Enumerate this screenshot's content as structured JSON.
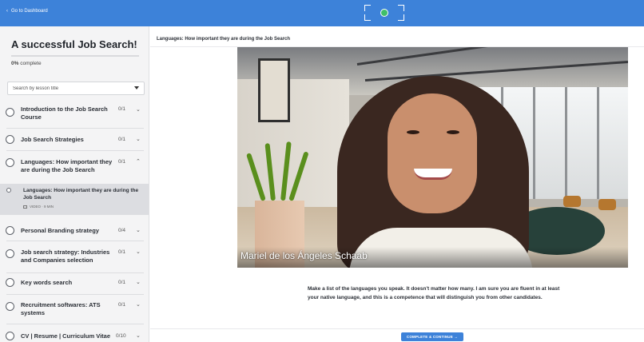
{
  "topbar": {
    "back_label": "Go to Dashboard",
    "back_icon": "chevron-left-icon",
    "logo_icon": "globe-icon",
    "accent_color": "#3d82d9"
  },
  "sidebar": {
    "course_title": "A successful Job Search!",
    "progress_percent": "0%",
    "progress_suffix": "complete",
    "progress_value": 0,
    "search_placeholder": "Search by lesson title",
    "lessons": [
      {
        "title": "Introduction to the Job Search Course",
        "count": "0/1",
        "expanded": false
      },
      {
        "title": "Job Search Strategies",
        "count": "0/1",
        "expanded": false
      },
      {
        "title": "Languages: How important they are during the Job Search",
        "count": "0/1",
        "expanded": true
      },
      {
        "title": "Personal Branding strategy",
        "count": "0/4",
        "expanded": false
      },
      {
        "title": "Job search strategy: Industries and Companies selection",
        "count": "0/1",
        "expanded": false
      },
      {
        "title": "Key words search",
        "count": "0/1",
        "expanded": false
      },
      {
        "title": "Recruitment softwares: ATS systems",
        "count": "0/1",
        "expanded": false
      },
      {
        "title": "CV | Resume | Curriculum Vitae",
        "count": "0/10",
        "expanded": false
      }
    ],
    "active_sublesson": {
      "title": "Languages: How important they are during the Job Search",
      "meta": "VIDEO · 9 MIN"
    }
  },
  "main": {
    "lesson_title": "Languages: How important they are during the Job Search",
    "video_speaker": "Mariel de los Ángeles Schaab",
    "description": "Make a list of the languages you speak. It doesn't matter how many. I am sure you are fluent in at least your native language, and this is a competence that will distinguish you from other candidates.",
    "complete_button": "COMPLETE & CONTINUE →"
  }
}
